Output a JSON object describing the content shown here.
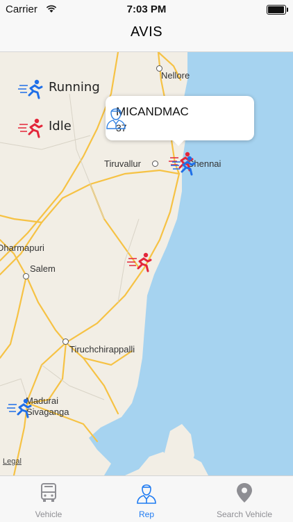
{
  "status_bar": {
    "carrier": "Carrier",
    "time": "7:03 PM",
    "battery_level": 0.9
  },
  "nav": {
    "title": "AVIS"
  },
  "map": {
    "legend": {
      "running": "Running",
      "idle": "Idle"
    },
    "cities": {
      "nellore": "Nellore",
      "chennai": "Chennai",
      "tiruvallur": "Tiruvallur",
      "dharmapuri": "Dharmapuri",
      "salem": "Salem",
      "tiruchchirappalli": "Tiruchchirappalli",
      "madurai": "Madurai",
      "sivaganga": "Sivaganga"
    },
    "legal": "Legal",
    "callout": {
      "name": "MICANDMAC",
      "count": "37"
    },
    "colors": {
      "running": "#1f6fe8",
      "idle": "#e3263a",
      "sea": "#a6d3f0",
      "land": "#f2eee5",
      "road": "#f6c244"
    }
  },
  "tabs": [
    {
      "label": "Vehicle",
      "icon": "bus-icon",
      "active": false
    },
    {
      "label": "Rep",
      "icon": "rep-icon",
      "active": true
    },
    {
      "label": "Search Vehicle",
      "icon": "location-pin-icon",
      "active": false
    }
  ]
}
